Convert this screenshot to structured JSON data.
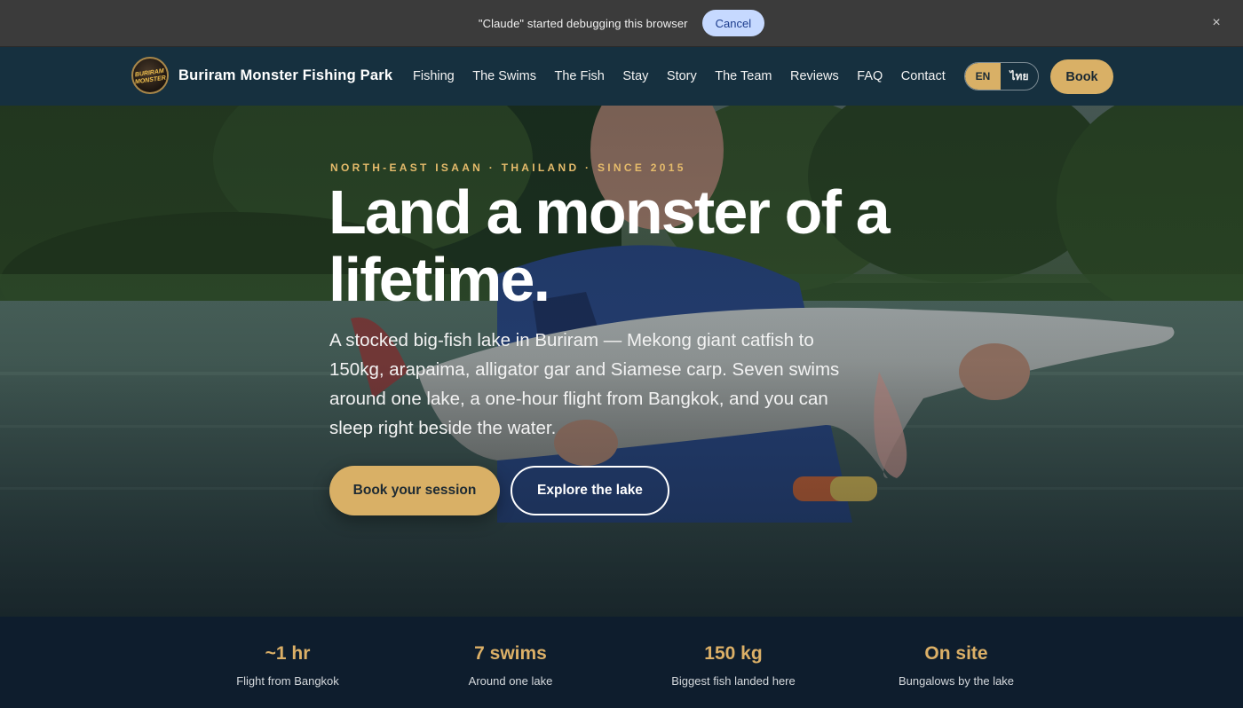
{
  "debug_bar": {
    "message": "\"Claude\" started debugging this browser",
    "cancel_label": "Cancel",
    "close_icon": "×"
  },
  "navbar": {
    "logo_text": "BURIRAM MONSTER",
    "brand_name": "Buriram Monster Fishing Park",
    "links": [
      "Fishing",
      "The Swims",
      "The Fish",
      "Stay",
      "Story",
      "The Team",
      "Reviews",
      "FAQ",
      "Contact"
    ],
    "lang_en": "EN",
    "lang_th": "ไทย",
    "book_label": "Book"
  },
  "hero": {
    "eyebrow": "NORTH-EAST ISAAN · THAILAND · SINCE 2015",
    "title": "Land a monster of a lifetime.",
    "subtitle": "A stocked big-fish lake in Buriram — Mekong giant catfish to 150kg, arapaima, alligator gar and Siamese carp. Seven swims around one lake, a one-hour flight from Bangkok, and you can sleep right beside the water.",
    "primary_cta": "Book your session",
    "secondary_cta": "Explore the lake"
  },
  "stats": [
    {
      "value": "~1 hr",
      "label": "Flight from Bangkok"
    },
    {
      "value": "7 swims",
      "label": "Around one lake"
    },
    {
      "value": "150 kg",
      "label": "Biggest fish landed here"
    },
    {
      "value": "On site",
      "label": "Bungalows by the lake"
    }
  ],
  "colors": {
    "accent": "#d9b066",
    "nav_bg": "#16303f",
    "stats_bg": "#0e1d2d",
    "debug_bg": "#3b3b3b"
  }
}
